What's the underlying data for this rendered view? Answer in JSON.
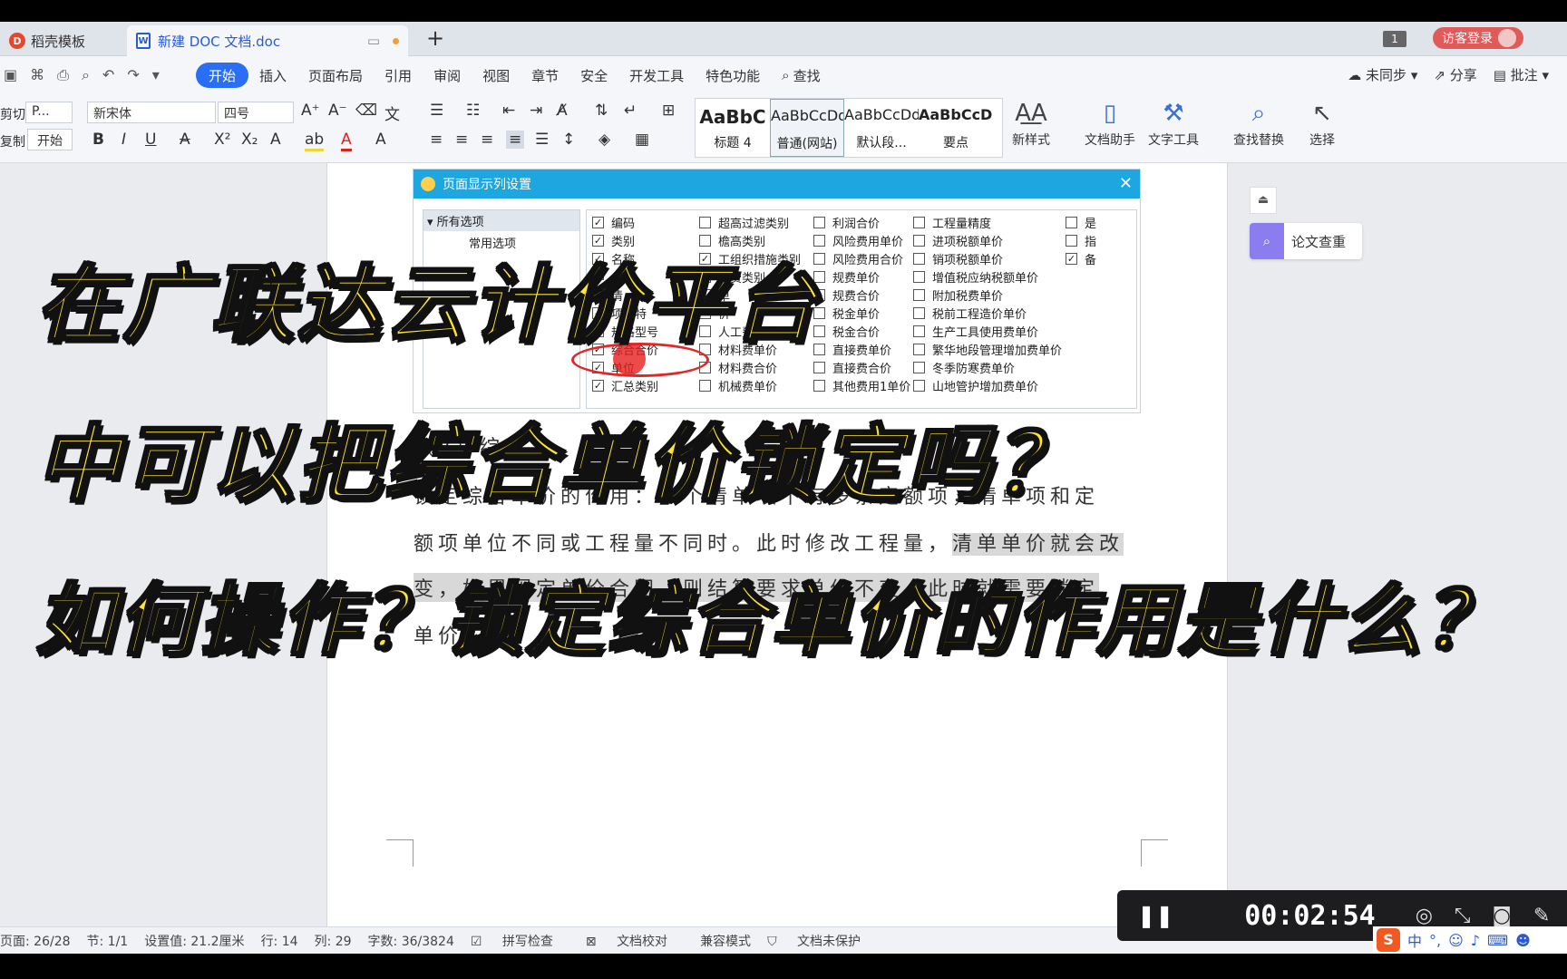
{
  "tabs": [
    {
      "label": "稻壳模板",
      "icon": "docer-logo-icon"
    },
    {
      "label": "新建 DOC 文档.doc",
      "icon": "word-doc-icon"
    }
  ],
  "window": {
    "badge": "1",
    "guest_login": "访客登录"
  },
  "menu": {
    "items": [
      "开始",
      "插入",
      "页面布局",
      "引用",
      "审阅",
      "视图",
      "章节",
      "安全",
      "开发工具",
      "特色功能",
      "查找"
    ],
    "active": "开始",
    "right": [
      "未同步",
      "分享",
      "批注"
    ]
  },
  "ribbon": {
    "cut": "剪切",
    "copy": "复制",
    "format_painter_tab": "开始",
    "paste_preview": "P...",
    "font_name": "新宋体",
    "font_size": "四号",
    "styles": [
      {
        "preview": "AaBbC",
        "label": "标题 4"
      },
      {
        "preview": "AaBbCcDd",
        "label": "普通(网站)"
      },
      {
        "preview": "AaBbCcDd",
        "label": "默认段..."
      },
      {
        "preview": "AaBbCcDd",
        "label": "要点"
      }
    ],
    "tools": [
      "新样式",
      "文档助手",
      "文字工具",
      "查找替换",
      "选择"
    ]
  },
  "dialog": {
    "title": "页面显示列设置",
    "tree_root": "所有选项",
    "tree_children": [
      "常用选项"
    ],
    "columns": [
      [
        {
          "label": "编码",
          "checked": true
        },
        {
          "label": "类别",
          "checked": true
        },
        {
          "label": "名称",
          "checked": true
        },
        {
          "label": "",
          "checked": true
        },
        {
          "label": "清",
          "checked": true
        },
        {
          "label": "项目特",
          "checked": true
        },
        {
          "label": "规格型号",
          "checked": false
        },
        {
          "label": "综合合价",
          "checked": true
        },
        {
          "label": "单位",
          "checked": true
        },
        {
          "label": "汇总类别",
          "checked": true
        }
      ],
      [
        {
          "label": "超高过滤类别",
          "checked": false
        },
        {
          "label": "檐高类别",
          "checked": false
        },
        {
          "label": "工组织措施类别",
          "checked": true
        },
        {
          "label": "增费类别",
          "checked": false
        },
        {
          "label": "单",
          "checked": false
        },
        {
          "label": "价",
          "checked": false
        },
        {
          "label": "人工费合价",
          "checked": false
        },
        {
          "label": "材料费单价",
          "checked": false
        },
        {
          "label": "材料费合价",
          "checked": false
        },
        {
          "label": "机械费单价",
          "checked": false
        }
      ],
      [
        {
          "label": "利润合价",
          "checked": false
        },
        {
          "label": "风险费用单价",
          "checked": false
        },
        {
          "label": "风险费用合价",
          "checked": false
        },
        {
          "label": "规费单价",
          "checked": false
        },
        {
          "label": "规费合价",
          "checked": false
        },
        {
          "label": "税金单价",
          "checked": false
        },
        {
          "label": "税金合价",
          "checked": false
        },
        {
          "label": "直接费单价",
          "checked": false
        },
        {
          "label": "直接费合价",
          "checked": false
        },
        {
          "label": "其他费用1单价",
          "checked": false
        }
      ],
      [
        {
          "label": "工程量精度",
          "checked": false
        },
        {
          "label": "进项税额单价",
          "checked": false
        },
        {
          "label": "销项税额单价",
          "checked": false
        },
        {
          "label": "增值税应纳税额单价",
          "checked": false
        },
        {
          "label": "附加税费单价",
          "checked": false
        },
        {
          "label": "税前工程造价单价",
          "checked": false
        },
        {
          "label": "生产工具使用费单价",
          "checked": false
        },
        {
          "label": "繁华地段管理增加费单价",
          "checked": false
        },
        {
          "label": "冬季防寒费单价",
          "checked": false
        },
        {
          "label": "山地管护增加费单价",
          "checked": false
        }
      ],
      [
        {
          "label": "是",
          "checked": false
        },
        {
          "label": "指",
          "checked": false
        },
        {
          "label": "备",
          "checked": true
        }
      ]
    ]
  },
  "document": {
    "line1_prefix": "（2）",
    "line1_suffix": "综",
    "line2": "锁定综合单价的作用：一个清单项下有多条定额项，清单项和定",
    "line3_plain": "额项单位不同或工程量不同时。此时修改工程量，",
    "line3_highlight": "清单单价就会改",
    "line4_highlight": "变，如果固定单价合同，则结算要求单价不变，此时就需要锁定",
    "line5": "单价"
  },
  "caption": {
    "line1": "在广联达云计价平台",
    "line2": "中可以把综合单价锁定吗？",
    "line3": "如何操作？锁定综合单价的作用是什么？"
  },
  "sidebar": {
    "paper_check": "论文查重"
  },
  "status": {
    "page": "页面: 26/28",
    "section": "节: 1/1",
    "setting": "设置值: 21.2厘米",
    "row": "行: 14",
    "col": "列: 29",
    "words": "字数: 36/3824",
    "spell": "拼写检查",
    "proof": "文档校对",
    "compat": "兼容模式",
    "protect": "文档未保护"
  },
  "recorder": {
    "time": "00:02:54"
  },
  "ime": {
    "lang": "中"
  }
}
